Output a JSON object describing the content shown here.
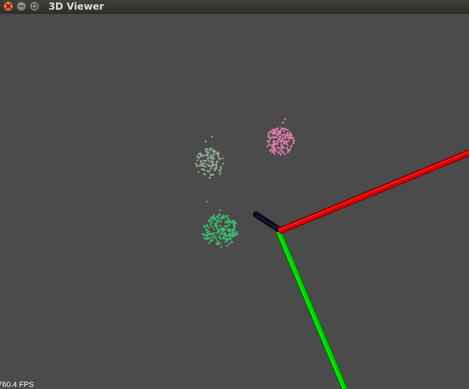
{
  "window": {
    "title": "3D Viewer",
    "controls": {
      "close": "close",
      "minimize": "minimize",
      "maximize": "maximize"
    }
  },
  "viewport": {
    "background_color": "#4b4b4b",
    "fps_text": "760.4 FPS",
    "axes": {
      "x_axis_color": "#e00000",
      "y_axis_color": "#00d000",
      "z_axis_color": "#0a0a1e"
    },
    "point_clouds": [
      {
        "name": "pink-cluster",
        "color": "#dd7aa8"
      },
      {
        "name": "gray-green-cluster",
        "color": "#8fa890"
      },
      {
        "name": "green-cluster",
        "color": "#3cb86a"
      }
    ]
  },
  "icons": {
    "close": "close-icon",
    "minimize": "minimize-icon",
    "maximize": "maximize-icon"
  }
}
